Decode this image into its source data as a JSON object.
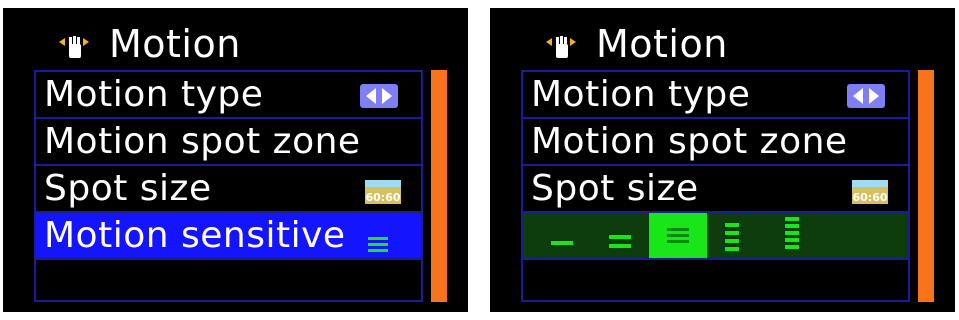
{
  "left_panel": {
    "title": "Motion",
    "title_icon": "hand-icon",
    "items": [
      {
        "label": "Motion type",
        "icon": "left-right-arrows-icon"
      },
      {
        "label": "Motion spot zone"
      },
      {
        "label": "Spot size",
        "icon": "spot-size-icon",
        "icon_text": "60:60"
      },
      {
        "label": "Motion sensitive",
        "icon": "sensitivity-level-icon",
        "selected": true
      }
    ]
  },
  "right_panel": {
    "title": "Motion",
    "title_icon": "hand-icon",
    "items": [
      {
        "label": "Motion type",
        "icon": "left-right-arrows-icon"
      },
      {
        "label": "Motion spot zone"
      },
      {
        "label": "Spot size",
        "icon": "spot-size-icon",
        "icon_text": "60:60"
      }
    ],
    "sensitivity_slider": {
      "levels": 5,
      "selected_level": 3
    }
  },
  "colors": {
    "background": "#000000",
    "text": "#ffffff",
    "border": "#1c1c9a",
    "selected_row": "#1414ff",
    "scrollbar": "#f7731c",
    "slider_bg": "#0d3d0d",
    "level_green": "#19e619",
    "icon_purple": "#7f7ff5"
  }
}
